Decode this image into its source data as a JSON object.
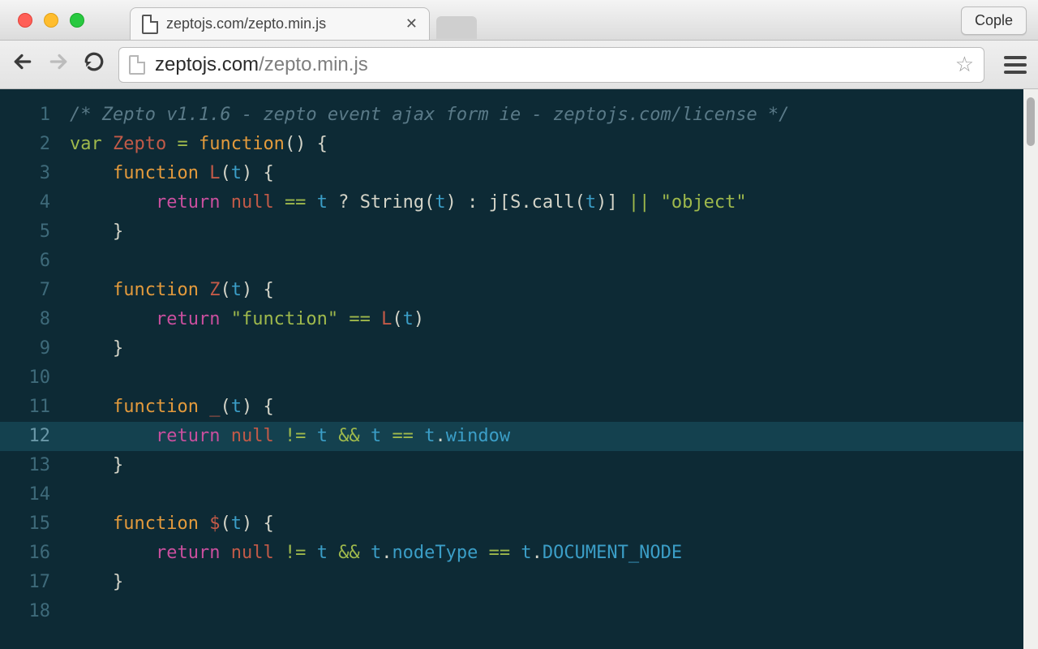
{
  "window": {
    "traffic_lights": [
      "close",
      "minimize",
      "zoom"
    ]
  },
  "tab": {
    "title": "zeptojs.com/zepto.min.js"
  },
  "top_button": {
    "label": "Cople"
  },
  "toolbar": {
    "back_enabled": true,
    "forward_enabled": false,
    "url_host": "zeptojs.com",
    "url_path": "/zepto.min.js"
  },
  "editor": {
    "highlighted_line": 12,
    "lines": [
      {
        "n": 1,
        "raw": "/* Zepto v1.1.6 - zepto event ajax form ie - zeptojs.com/license */"
      },
      {
        "n": 2,
        "raw": "var Zepto = function() {"
      },
      {
        "n": 3,
        "raw": "    function L(t) {"
      },
      {
        "n": 4,
        "raw": "        return null == t ? String(t) : j[S.call(t)] || \"object\""
      },
      {
        "n": 5,
        "raw": "    }"
      },
      {
        "n": 6,
        "raw": ""
      },
      {
        "n": 7,
        "raw": "    function Z(t) {"
      },
      {
        "n": 8,
        "raw": "        return \"function\" == L(t)"
      },
      {
        "n": 9,
        "raw": "    }"
      },
      {
        "n": 10,
        "raw": ""
      },
      {
        "n": 11,
        "raw": "    function _(t) {"
      },
      {
        "n": 12,
        "raw": "        return null != t && t == t.window"
      },
      {
        "n": 13,
        "raw": "    }"
      },
      {
        "n": 14,
        "raw": ""
      },
      {
        "n": 15,
        "raw": "    function $(t) {"
      },
      {
        "n": 16,
        "raw": "        return null != t && t.nodeType == t.DOCUMENT_NODE"
      },
      {
        "n": 17,
        "raw": "    }"
      },
      {
        "n": 18,
        "raw": ""
      }
    ],
    "tokens": {
      "1": [
        [
          "comment",
          "/* Zepto v1.1.6 - zepto event ajax form ie - zeptojs.com/license */"
        ]
      ],
      "2": [
        [
          "kw",
          "var "
        ],
        [
          "name",
          "Zepto"
        ],
        [
          "punc",
          " "
        ],
        [
          "op",
          "="
        ],
        [
          "punc",
          " "
        ],
        [
          "type",
          "function"
        ],
        [
          "punc",
          "() {"
        ]
      ],
      "3": [
        [
          "punc",
          "    "
        ],
        [
          "type",
          "function"
        ],
        [
          "punc",
          " "
        ],
        [
          "name",
          "L"
        ],
        [
          "punc",
          "("
        ],
        [
          "param",
          "t"
        ],
        [
          "punc",
          ") {"
        ]
      ],
      "4": [
        [
          "punc",
          "        "
        ],
        [
          "return",
          "return"
        ],
        [
          "punc",
          " "
        ],
        [
          "null",
          "null"
        ],
        [
          "punc",
          " "
        ],
        [
          "op",
          "=="
        ],
        [
          "punc",
          " "
        ],
        [
          "param",
          "t"
        ],
        [
          "punc",
          " ? "
        ],
        [
          "fn",
          "String"
        ],
        [
          "punc",
          "("
        ],
        [
          "param",
          "t"
        ],
        [
          "punc",
          ") : "
        ],
        [
          "fn",
          "j"
        ],
        [
          "punc",
          "["
        ],
        [
          "fn",
          "S.call"
        ],
        [
          "punc",
          "("
        ],
        [
          "param",
          "t"
        ],
        [
          "punc",
          ")] "
        ],
        [
          "op",
          "||"
        ],
        [
          "punc",
          " "
        ],
        [
          "str",
          "\"object\""
        ]
      ],
      "5": [
        [
          "punc",
          "    }"
        ]
      ],
      "6": [
        [
          "punc",
          ""
        ]
      ],
      "7": [
        [
          "punc",
          "    "
        ],
        [
          "type",
          "function"
        ],
        [
          "punc",
          " "
        ],
        [
          "name",
          "Z"
        ],
        [
          "punc",
          "("
        ],
        [
          "param",
          "t"
        ],
        [
          "punc",
          ") {"
        ]
      ],
      "8": [
        [
          "punc",
          "        "
        ],
        [
          "return",
          "return"
        ],
        [
          "punc",
          " "
        ],
        [
          "str",
          "\"function\""
        ],
        [
          "punc",
          " "
        ],
        [
          "op",
          "=="
        ],
        [
          "punc",
          " "
        ],
        [
          "name",
          "L"
        ],
        [
          "punc",
          "("
        ],
        [
          "param",
          "t"
        ],
        [
          "punc",
          ")"
        ]
      ],
      "9": [
        [
          "punc",
          "    }"
        ]
      ],
      "10": [
        [
          "punc",
          ""
        ]
      ],
      "11": [
        [
          "punc",
          "    "
        ],
        [
          "type",
          "function"
        ],
        [
          "punc",
          " "
        ],
        [
          "name",
          "_"
        ],
        [
          "punc",
          "("
        ],
        [
          "param",
          "t"
        ],
        [
          "punc",
          ") {"
        ]
      ],
      "12": [
        [
          "punc",
          "        "
        ],
        [
          "return",
          "return"
        ],
        [
          "punc",
          " "
        ],
        [
          "null",
          "null"
        ],
        [
          "punc",
          " "
        ],
        [
          "op",
          "!="
        ],
        [
          "punc",
          " "
        ],
        [
          "param",
          "t"
        ],
        [
          "punc",
          " "
        ],
        [
          "op",
          "&&"
        ],
        [
          "punc",
          " "
        ],
        [
          "param",
          "t"
        ],
        [
          "punc",
          " "
        ],
        [
          "op",
          "=="
        ],
        [
          "punc",
          " "
        ],
        [
          "param",
          "t"
        ],
        [
          "punc",
          "."
        ],
        [
          "prop",
          "window"
        ]
      ],
      "13": [
        [
          "punc",
          "    }"
        ]
      ],
      "14": [
        [
          "punc",
          ""
        ]
      ],
      "15": [
        [
          "punc",
          "    "
        ],
        [
          "type",
          "function"
        ],
        [
          "punc",
          " "
        ],
        [
          "name",
          "$"
        ],
        [
          "punc",
          "("
        ],
        [
          "param",
          "t"
        ],
        [
          "punc",
          ") {"
        ]
      ],
      "16": [
        [
          "punc",
          "        "
        ],
        [
          "return",
          "return"
        ],
        [
          "punc",
          " "
        ],
        [
          "null",
          "null"
        ],
        [
          "punc",
          " "
        ],
        [
          "op",
          "!="
        ],
        [
          "punc",
          " "
        ],
        [
          "param",
          "t"
        ],
        [
          "punc",
          " "
        ],
        [
          "op",
          "&&"
        ],
        [
          "punc",
          " "
        ],
        [
          "param",
          "t"
        ],
        [
          "punc",
          "."
        ],
        [
          "prop",
          "nodeType"
        ],
        [
          "punc",
          " "
        ],
        [
          "op",
          "=="
        ],
        [
          "punc",
          " "
        ],
        [
          "param",
          "t"
        ],
        [
          "punc",
          "."
        ],
        [
          "prop",
          "DOCUMENT_NODE"
        ]
      ],
      "17": [
        [
          "punc",
          "    }"
        ]
      ],
      "18": [
        [
          "punc",
          ""
        ]
      ]
    }
  }
}
